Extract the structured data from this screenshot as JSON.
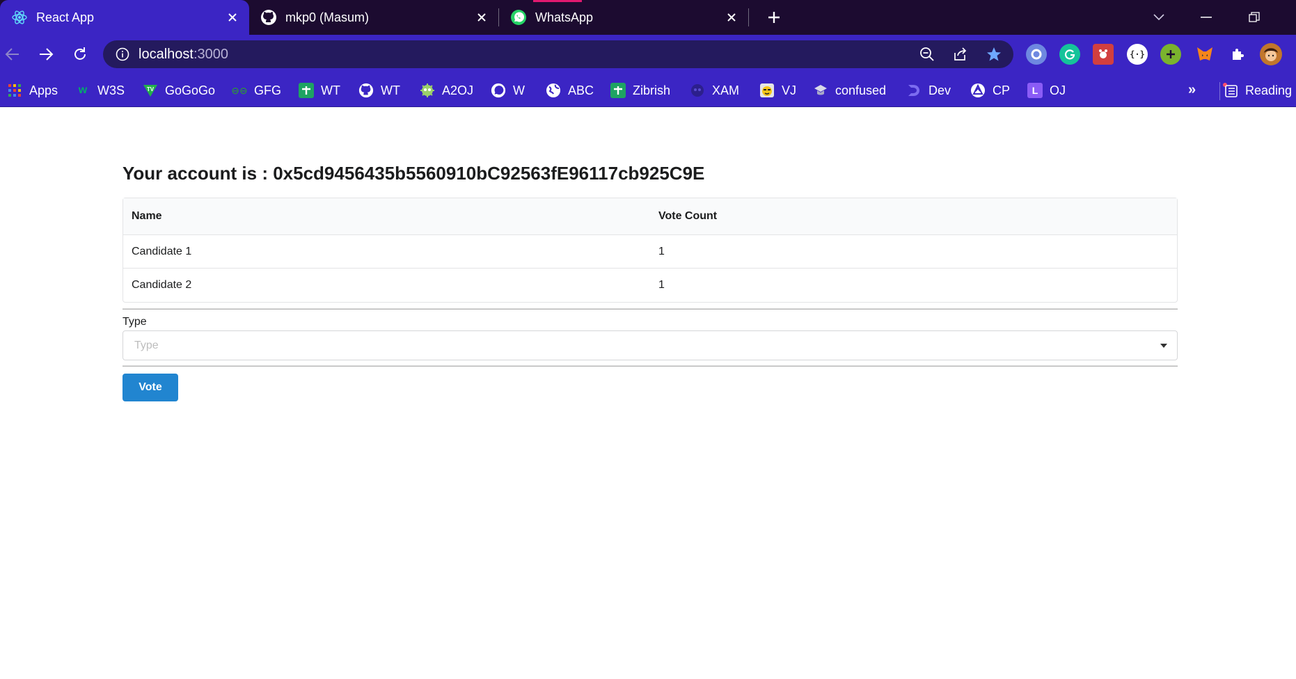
{
  "browser": {
    "tabs": [
      {
        "title": "React App",
        "icon": "react-icon",
        "active": true
      },
      {
        "title": "mkp0 (Masum)",
        "icon": "github-icon",
        "active": false
      },
      {
        "title": "WhatsApp",
        "icon": "whatsapp-icon",
        "active": false
      }
    ],
    "address": {
      "host": "localhost",
      "port": ":3000"
    },
    "bookmarks": [
      {
        "label": "Apps",
        "icon": "apps-grid-icon"
      },
      {
        "label": "W3S",
        "icon": "w3schools-icon"
      },
      {
        "label": "GoGoGo",
        "icon": "tv-icon"
      },
      {
        "label": "GFG",
        "icon": "gfg-icon"
      },
      {
        "label": "WT",
        "icon": "wt-plus-icon"
      },
      {
        "label": "WT",
        "icon": "github-icon"
      },
      {
        "label": "A2OJ",
        "icon": "a2oj-icon"
      },
      {
        "label": "W",
        "icon": "whatsapp-icon"
      },
      {
        "label": "ABC",
        "icon": "globe-icon"
      },
      {
        "label": "Zibrish",
        "icon": "zibrish-plus-icon"
      },
      {
        "label": "XAM",
        "icon": "xam-icon"
      },
      {
        "label": "VJ",
        "icon": "vj-icon"
      },
      {
        "label": "confused",
        "icon": "confused-icon"
      },
      {
        "label": "Dev",
        "icon": "dev-icon"
      },
      {
        "label": "CP",
        "icon": "cp-icon"
      },
      {
        "label": "OJ",
        "icon": "oj-icon"
      }
    ],
    "more_label": "»",
    "reading_label": "Reading"
  },
  "page": {
    "account_heading": "Your account is : 0x5cd9456435b5560910bC92563fE96117cb925C9E",
    "table": {
      "headers": [
        "Name",
        "Vote Count"
      ],
      "rows": [
        {
          "name": "Candidate 1",
          "votes": "1"
        },
        {
          "name": "Candidate 2",
          "votes": "1"
        }
      ]
    },
    "type_label": "Type",
    "type_placeholder": "Type",
    "vote_button": "Vote"
  },
  "colors": {
    "tabbar": "#1c0b30",
    "toolbar": "#3b25c4",
    "button": "#2185d0"
  }
}
